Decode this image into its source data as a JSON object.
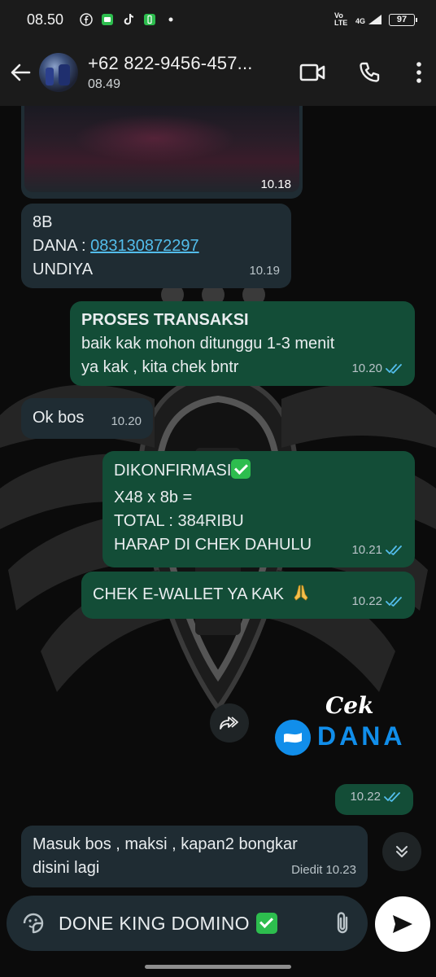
{
  "status_bar": {
    "time": "08.50",
    "network": "4G",
    "volte": "Vo LTE",
    "battery": "97"
  },
  "header": {
    "contact_name": "+62 822-9456-457...",
    "contact_status": "08.49"
  },
  "messages": [
    {
      "type": "media",
      "direction": "in",
      "time": "10.18"
    },
    {
      "type": "text",
      "direction": "in",
      "lines": [
        "8B"
      ],
      "dana_label": "DANA : ",
      "dana_number": "083130872297",
      "last_line": "UNDIYA",
      "time": "10.19"
    },
    {
      "type": "text",
      "direction": "out",
      "title": "PROSES TRANSAKSI",
      "lines": [
        "baik kak mohon ditunggu 1-3 menit",
        "ya kak , kita chek bntr"
      ],
      "time": "10.20",
      "read": true
    },
    {
      "type": "text",
      "direction": "in",
      "lines": [
        "Ok bos"
      ],
      "time": "10.20"
    },
    {
      "type": "text",
      "direction": "out",
      "lines": [
        "DIKONFIRMASI",
        "X48 x 8b =",
        "TOTAL : 384RIBU",
        "HARAP DI CHEK DAHULU"
      ],
      "time": "10.21",
      "read": true
    },
    {
      "type": "text",
      "direction": "out",
      "lines": [
        "CHEK E-WALLET YA KAK"
      ],
      "time": "10.22",
      "read": true
    },
    {
      "type": "sticker",
      "direction": "out",
      "caption": "Cek",
      "brand": "DANA",
      "time": "10.22",
      "read": true
    },
    {
      "type": "text",
      "direction": "in",
      "lines": [
        "Masuk bos , maksi , kapan2 bongkar",
        "disini lagi"
      ],
      "edited_label": "Diedit",
      "time": "10.23"
    }
  ],
  "composer": {
    "text": "DONE KING DOMINO"
  },
  "colors": {
    "incoming_bubble": "#1f2c33",
    "outgoing_bubble": "#134d37",
    "read_ticks": "#53bdeb",
    "link": "#53bdeb",
    "dana_blue": "#118eea"
  },
  "icons": {
    "back": "back-arrow-icon",
    "video": "video-call-icon",
    "call": "phone-icon",
    "menu": "more-vertical-icon",
    "sticker": "sticker-icon",
    "attach": "paperclip-icon",
    "send": "send-icon",
    "forward": "forward-icon",
    "scroll": "scroll-down-icon"
  }
}
